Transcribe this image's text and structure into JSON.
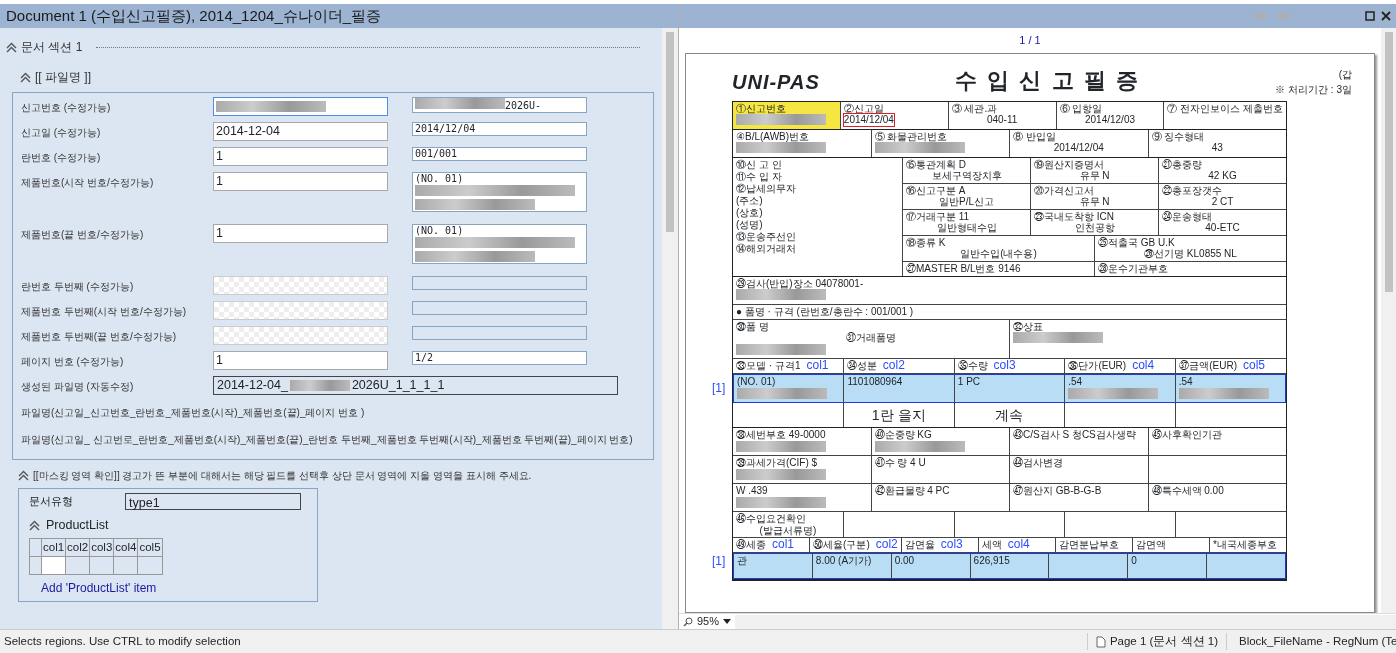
{
  "window": {
    "title": "Document 1 (수입신고필증), 2014_1204_슈나이더_필증"
  },
  "form_panel": {
    "section": "문서 섹션 1",
    "group": "[[ 파일명 ]]",
    "fields": [
      {
        "label": "신고번호 (수정가능)",
        "redacted": true,
        "focused": true,
        "preview": "2026U-",
        "disabled": false
      },
      {
        "label": "신고일 (수정가능)",
        "value": "2014-12-04",
        "preview": "2014/12/04",
        "disabled": false
      },
      {
        "label": "란번호 (수정가능)",
        "value": "1",
        "preview": "001/001",
        "disabled": false
      },
      {
        "label": "제품번호(시작 번호/수정가능)",
        "value": "1",
        "preview": "(NO. 01)",
        "preview_redacted": true,
        "disabled": false
      },
      {
        "label": "제품번호(끝 번호/수정가능)",
        "value": "1",
        "preview": "(NO. 01)",
        "preview_redacted": true,
        "disabled": false
      },
      {
        "label": "란번호 두번째 (수정가능)",
        "disabled": true
      },
      {
        "label": "제품번호 두번째(시작 번호/수정가능)",
        "disabled": true
      },
      {
        "label": "제품번호 두번째(끝 번호/수정가능)",
        "disabled": true
      },
      {
        "label": "페이지 번호 (수정가능)",
        "value": "1",
        "preview": "1/2",
        "disabled": false
      }
    ],
    "generated": {
      "label": "생성된 파일명 (자동수정)",
      "value_start": "2014-12-04_",
      "value_end": "2026U_1_1_1_1"
    },
    "notes": [
      "파일명(신고일_신고번호_란번호_제품번호(시작)_제품번호(끝)_페이지 번호 )",
      "파일명(신고일_ 신고번로_란번호_제품번호(시작)_제품번호(끝)_란번호 두번째_제품번호 두번째(시작)_제품번호 두번째(끝)_페이지 번호)"
    ],
    "masking_note": "[[마스킹 영역 확인]] 경고가 뜬 부분에 대해서는 해당 필드를 선택후 상단 문서 영역에 지울 영역을 표시해 주세요.",
    "doc_type": {
      "label": "문서유형",
      "value": "type1"
    },
    "product_list": {
      "title": "ProductList",
      "columns": [
        {
          "label": "col1",
          "selected": true
        },
        {
          "label": "col2",
          "selected": false
        },
        {
          "label": "col3",
          "selected": false
        },
        {
          "label": "col4",
          "selected": false
        },
        {
          "label": "col5",
          "selected": false
        }
      ],
      "add_link": "Add 'ProductList' item"
    }
  },
  "viewer": {
    "page_counter": "1 / 1",
    "zoom": "95%",
    "form": {
      "logo": "UNI-PAS",
      "title": "수 입 신 고 필 증",
      "copy_mark": "(갑",
      "period": "※ 처리기간 : 3일",
      "blocks": [
        {
          "kind": "grid",
          "rows": [
            {
              "cells": [
                {
                  "lines": [
                    "①신고번호"
                  ],
                  "redacted": true,
                  "warning": true
                },
                {
                  "lines": [
                    "②신고일",
                    "2014/12/04"
                  ],
                  "selected": true
                },
                {
                  "lines": [
                    "③ 세관.과",
                    "040-11"
                  ]
                },
                {
                  "lines": [
                    "⑥ 입항일",
                    "2014/12/03"
                  ]
                },
                {
                  "lines": [
                    "⑦ 전자인보이스 제출번호"
                  ]
                }
              ]
            }
          ]
        },
        {
          "kind": "grid",
          "rows": [
            {
              "cells": [
                {
                  "lines": [
                    "④B/L(AWB)번호"
                  ],
                  "redacted": true
                },
                {
                  "lines": [
                    "⑤ 화물관리번호"
                  ],
                  "redacted": true
                },
                {
                  "lines": [
                    "⑧ 반입일",
                    "2014/12/04"
                  ]
                },
                {
                  "lines": [
                    "⑨ 징수형태",
                    "43"
                  ]
                }
              ]
            }
          ]
        },
        {
          "kind": "parties",
          "labels": [
            "⑩신 고 인",
            "⑪수 입 자",
            "⑫납세의무자",
            "(주소)",
            "(상호)",
            "(성명)",
            "⑬운송주선인",
            "⑭해외거래처"
          ],
          "rows": [
            {
              "cells": [
                {
                  "lines": [
                    "⑮통관계획 D",
                    "보세구역장치후"
                  ]
                },
                {
                  "lines": [
                    "⑲원산지증명서",
                    "유무 N"
                  ]
                },
                {
                  "lines": [
                    "㉑총중량",
                    "42 KG"
                  ]
                }
              ]
            },
            {
              "cells": [
                {
                  "lines": [
                    "⑯신고구분 A",
                    "일반P/L신고"
                  ]
                },
                {
                  "lines": [
                    "⑳가격신고서",
                    "유무 N"
                  ]
                },
                {
                  "lines": [
                    "㉒총포장갯수",
                    "2 CT"
                  ]
                }
              ]
            },
            {
              "cells": [
                {
                  "lines": [
                    "⑰거래구분 11",
                    "일반형태수입"
                  ]
                },
                {
                  "lines": [
                    "㉓국내도착항 ICN",
                    "인천공항"
                  ]
                },
                {
                  "lines": [
                    "㉔운송형태",
                    "40-ETC"
                  ]
                }
              ]
            },
            {
              "cells": [
                {
                  "lines": [
                    "⑱종류 K",
                    "일반수입(내수용)"
                  ]
                },
                {
                  "lines": [
                    "㉕적출국 GB U.K",
                    "㉖선기명 KL0855 NL"
                  ]
                }
              ]
            },
            {
              "cells": [
                {
                  "lines": [
                    "㉗MASTER B/L번호 9146"
                  ]
                },
                {
                  "lines": [
                    "㉘운수기관부호"
                  ]
                }
              ]
            }
          ]
        },
        {
          "kind": "grid",
          "rows": [
            {
              "cells": [
                {
                  "lines": [
                    "㉙검사(반입)장소 04078001-"
                  ],
                  "redacted": true
                }
              ]
            },
            {
              "cells": [
                {
                  "lines": [
                    "● 품명 · 규격 (란번호/총란수 : 001/001 )"
                  ]
                }
              ]
            },
            {
              "cells": [
                {
                  "lines": [
                    "㉚품 명",
                    "㉛거래품명"
                  ],
                  "redacted": true
                },
                {
                  "lines": [
                    "㉜상표"
                  ],
                  "redacted": true
                }
              ]
            },
            {
              "kind": "header",
              "cells": [
                {
                  "lines": [
                    "㉝모델 · 규격1"
                  ],
                  "overlay": "col1"
                },
                {
                  "lines": [
                    "㉞성분"
                  ],
                  "overlay": "col2"
                },
                {
                  "lines": [
                    "㉟수량"
                  ],
                  "overlay": "col3"
                },
                {
                  "lines": [
                    "㊱단가(EUR)"
                  ],
                  "overlay": "col4"
                },
                {
                  "lines": [
                    "㊲금액(EUR)"
                  ],
                  "overlay": "col5"
                }
              ]
            },
            {
              "kind": "item",
              "marker": "[1]",
              "cells": [
                {
                  "lines": [
                    "(NO. 01)"
                  ],
                  "redacted": true
                },
                {
                  "lines": [
                    "1101080964"
                  ]
                },
                {
                  "lines": [
                    "1 PC"
                  ]
                },
                {
                  "lines": [
                    ".54"
                  ],
                  "redacted": true
                },
                {
                  "lines": [
                    ".54"
                  ],
                  "redacted": true
                }
              ]
            },
            {
              "kind": "big",
              "cells": [
                {},
                {
                  "lines": [
                    "1란 을지"
                  ]
                },
                {
                  "lines": [
                    "계속"
                  ]
                },
                {},
                {}
              ]
            }
          ]
        },
        {
          "kind": "grid",
          "rows": [
            {
              "cells": [
                {
                  "lines": [
                    "㊳세번부호 49-0000"
                  ],
                  "redacted": true
                },
                {
                  "lines": [
                    "㊵순중량 KG"
                  ],
                  "redacted": true
                },
                {
                  "lines": [
                    "㊸C/S검사 S 청CS검사생략"
                  ]
                },
                {
                  "lines": [
                    "㊺사후확인기관"
                  ]
                }
              ]
            },
            {
              "cells": [
                {
                  "lines": [
                    "㊴과세가격(CIF) $"
                  ],
                  "redacted": true
                },
                {
                  "lines": [
                    "㊶수 량 4 U"
                  ]
                },
                {
                  "lines": [
                    "㊹검사변경"
                  ]
                },
                {}
              ]
            },
            {
              "cells": [
                {
                  "lines": [
                    "W .439"
                  ],
                  "redacted": true
                },
                {
                  "lines": [
                    "㊷환급물량 4 PC"
                  ]
                },
                {
                  "lines": [
                    "㊼원산지 GB-B-G-B"
                  ]
                },
                {
                  "lines": [
                    "㊽특수세액 0.00"
                  ]
                }
              ]
            },
            {
              "cells": [
                {
                  "lines": [
                    "㊻수입요건확인",
                    "(발급서류명)"
                  ]
                },
                {},
                {},
                {},
                {}
              ]
            },
            {
              "kind": "header",
              "cells": [
                {
                  "lines": [
                    "㊾세종"
                  ],
                  "overlay": "col1"
                },
                {
                  "lines": [
                    "㊿세율(구분)"
                  ],
                  "overlay": "col2"
                },
                {
                  "lines": [
                    "감면율"
                  ],
                  "overlay": "col3"
                },
                {
                  "lines": [
                    "세액"
                  ],
                  "overlay": "col4"
                },
                {
                  "lines": [
                    "감면분납부호"
                  ]
                },
                {
                  "lines": [
                    "감면액"
                  ]
                },
                {
                  "lines": [
                    "*내국세종부호"
                  ]
                }
              ]
            },
            {
              "kind": "item",
              "marker": "[1]",
              "cells": [
                {
                  "lines": [
                    "관"
                  ]
                },
                {
                  "lines": [
                    "8.00 (A기가)"
                  ]
                },
                {
                  "lines": [
                    "0.00"
                  ]
                },
                {
                  "lines": [
                    "626,915"
                  ]
                },
                {},
                {
                  "lines": [
                    "0"
                  ]
                },
                {}
              ]
            }
          ]
        }
      ]
    }
  },
  "status_bar": {
    "message": "Selects regions. Use CTRL to modify selection",
    "page": "Page 1 (문서 섹션 1)",
    "block": "Block_FileName - RegNum (Te"
  }
}
